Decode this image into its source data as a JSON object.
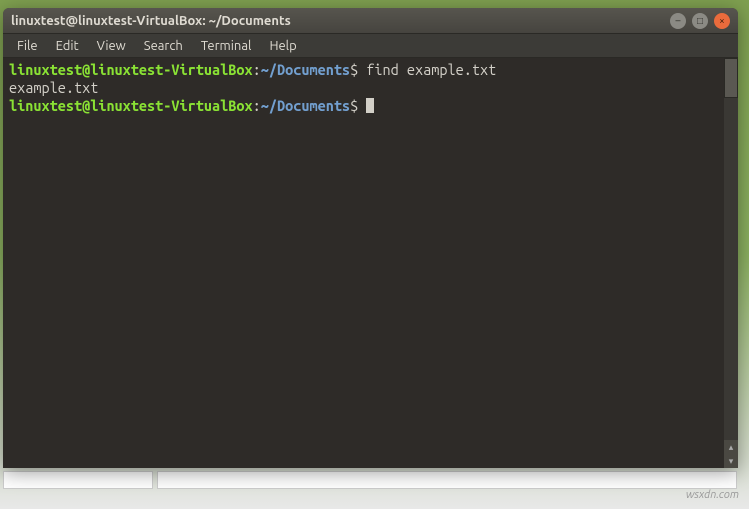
{
  "window": {
    "title": "linuxtest@linuxtest-VirtualBox: ~/Documents"
  },
  "menubar": {
    "items": [
      "File",
      "Edit",
      "View",
      "Search",
      "Terminal",
      "Help"
    ]
  },
  "terminal": {
    "lines": [
      {
        "userhost": "linuxtest@linuxtest-VirtualBox",
        "colon": ":",
        "path": "~/Documents",
        "dollar": "$",
        "command": " find example.txt"
      },
      {
        "output": "example.txt"
      },
      {
        "userhost": "linuxtest@linuxtest-VirtualBox",
        "colon": ":",
        "path": "~/Documents",
        "dollar": "$",
        "command": " ",
        "cursor": true
      }
    ]
  },
  "watermark": "wsxdn.com"
}
